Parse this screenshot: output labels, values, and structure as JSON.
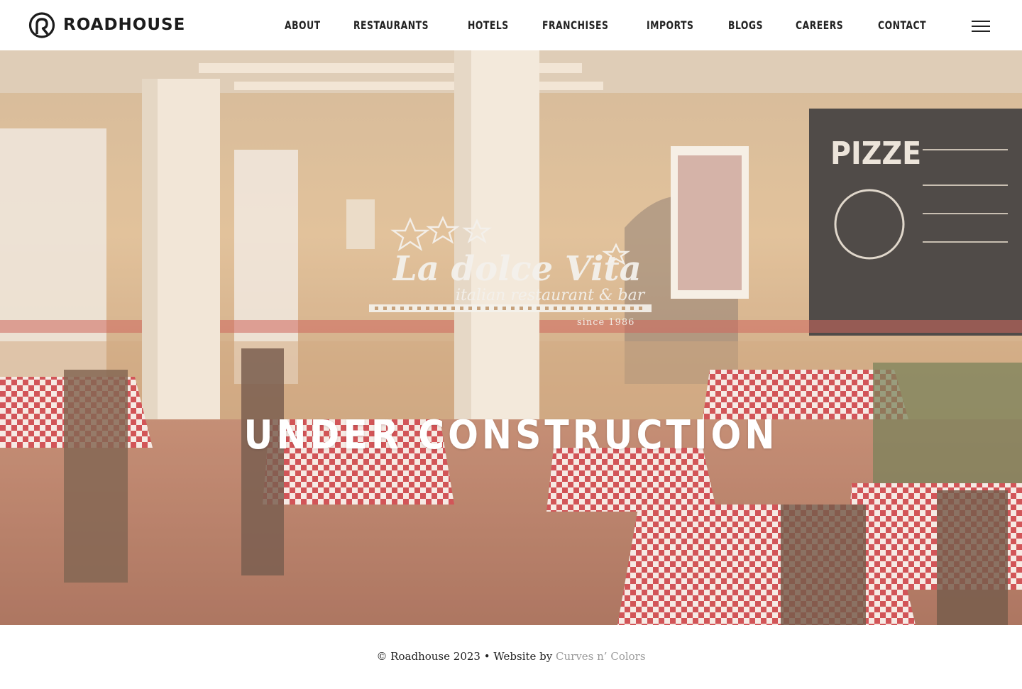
{
  "header": {
    "logo_text": "ROADHOUSE",
    "nav": [
      {
        "label": "ABOUT"
      },
      {
        "label": "RESTAURANTS"
      },
      {
        "label": "HOTELS"
      },
      {
        "label": "FRANCHISES"
      },
      {
        "label": "IMPORTS"
      },
      {
        "label": "BLOGS"
      },
      {
        "label": "CAREERS"
      },
      {
        "label": "CONTACT"
      }
    ],
    "menu_icon": "hamburger-icon"
  },
  "hero": {
    "restaurant_logo": {
      "name": "La dolce Vita",
      "tagline": "italian restaurant & bar",
      "since": "since 1986"
    },
    "title": "UNDER CONSTRUCTION"
  },
  "footer": {
    "copyright": "© Roadhouse 2023 • Website by ",
    "credit_link": "Curves n’ Colors"
  },
  "colors": {
    "accent_link": "#9a9a9a",
    "header_bg": "#ffffff",
    "checkered": "#c9343a"
  }
}
